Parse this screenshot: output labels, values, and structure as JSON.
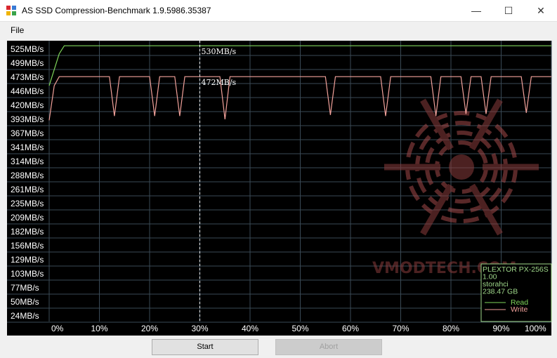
{
  "window": {
    "title": "AS SSD Compression-Benchmark 1.9.5986.35387",
    "controls": {
      "minimize": "—",
      "maximize": "☐",
      "close": "✕"
    }
  },
  "menu": {
    "file": "File"
  },
  "buttons": {
    "start": "Start",
    "abort": "Abort"
  },
  "watermark": "VMODTECH.COM",
  "device_info": {
    "model": "PLEXTOR PX-256S",
    "version": "1.00",
    "driver": "storahci",
    "capacity": "238.47 GB",
    "legend_read": "Read",
    "legend_write": "Write"
  },
  "colors": {
    "read": "#7fd65a",
    "write": "#f2a19a",
    "info_text": "#9fd88a",
    "background": "#000000",
    "grid": "#3a4a56"
  },
  "chart_data": {
    "type": "line",
    "x_unit": "%",
    "xlim": [
      0,
      100
    ],
    "ylim": [
      0,
      550
    ],
    "x_tick_labels": [
      "0%",
      "10%",
      "20%",
      "30%",
      "40%",
      "50%",
      "60%",
      "70%",
      "80%",
      "90%",
      "100%"
    ],
    "y_tick_labels": [
      "525MB/s",
      "499MB/s",
      "473MB/s",
      "446MB/s",
      "420MB/s",
      "393MB/s",
      "367MB/s",
      "341MB/s",
      "314MB/s",
      "288MB/s",
      "261MB/s",
      "235MB/s",
      "209MB/s",
      "182MB/s",
      "156MB/s",
      "129MB/s",
      "103MB/s",
      "77MB/s",
      "50MB/s",
      "24MB/s"
    ],
    "marker_x": 30,
    "annotations": [
      {
        "text": "530MB/s",
        "x": 30,
        "y": 530
      },
      {
        "text": "472MB/s",
        "x": 30,
        "y": 472
      }
    ],
    "series": [
      {
        "name": "Read",
        "x": [
          0,
          2,
          3,
          10,
          20,
          30,
          40,
          50,
          60,
          70,
          80,
          90,
          100
        ],
        "y": [
          455,
          515,
          530,
          530,
          530,
          530,
          530,
          530,
          530,
          530,
          530,
          530,
          530
        ]
      },
      {
        "name": "Write",
        "x": [
          0,
          1,
          2,
          5,
          12,
          13,
          14,
          17,
          20,
          21,
          22,
          25,
          26,
          27,
          30,
          33,
          34,
          35,
          36,
          37,
          38,
          41,
          44,
          47,
          55,
          56,
          57,
          60,
          61,
          62,
          64,
          66,
          67,
          68,
          71,
          76,
          77,
          78,
          82,
          83,
          84,
          86,
          87,
          88,
          89,
          94,
          95,
          96,
          99,
          100
        ],
        "y": [
          390,
          455,
          472,
          472,
          472,
          398,
          472,
          472,
          472,
          398,
          472,
          472,
          398,
          472,
          472,
          472,
          472,
          392,
          472,
          472,
          472,
          472,
          472,
          472,
          472,
          400,
          472,
          472,
          472,
          472,
          472,
          472,
          398,
          472,
          472,
          472,
          398,
          472,
          472,
          402,
          472,
          472,
          402,
          472,
          472,
          472,
          404,
          472,
          472,
          472
        ]
      }
    ]
  }
}
